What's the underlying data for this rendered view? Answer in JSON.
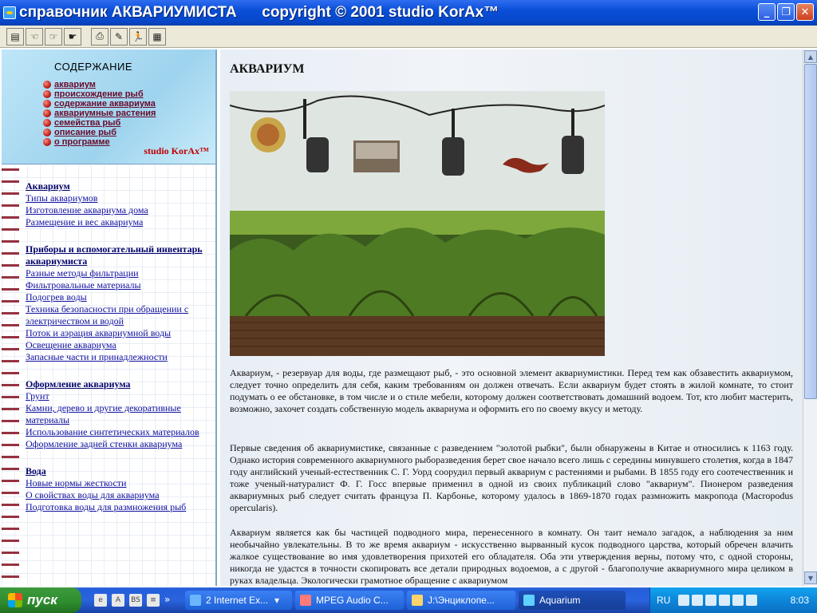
{
  "window": {
    "title": "справочник АКВАРИУМИСТА      copyright © 2001 studio KorAx™",
    "minimize": "_",
    "maximize": "❐",
    "close": "✕"
  },
  "toolbar": {
    "buttons": [
      {
        "icon": "contents-icon",
        "glyph": "▤"
      },
      {
        "icon": "back-hand-icon",
        "glyph": "☜"
      },
      {
        "icon": "forward-hand-icon",
        "glyph": "☞"
      },
      {
        "icon": "pointer-hand-icon",
        "glyph": "☛"
      },
      {
        "icon": "print-icon",
        "glyph": "⎙"
      },
      {
        "icon": "tools-icon",
        "glyph": "✎"
      },
      {
        "icon": "exit-runner-icon",
        "glyph": "🏃"
      },
      {
        "icon": "film-icon",
        "glyph": "▦"
      }
    ]
  },
  "toc": {
    "title": "СОДЕРЖАНИЕ",
    "items": [
      "аквариум",
      "происхождение рыб",
      "содержание аквариума",
      "аквариумные растения",
      "семейства рыб",
      "описание рыб",
      "о программе"
    ],
    "studio": "studio KorAx™"
  },
  "nav": {
    "sections": [
      {
        "head": "Аквариум",
        "items": [
          "Типы аквариумов",
          "Изготовление аквариума дома",
          "Размещение и вес аквариума"
        ]
      },
      {
        "head": "Приборы и вспомогательный инвентарь аквариумиста",
        "items": [
          "Разные методы фильтрации",
          "Фильтровальные материалы",
          "Подогрев воды",
          "Техника безопасности при обращении с электричеством и водой",
          "Поток и аэрация аквариумной воды",
          "Освещение аквариума",
          "Запасные части и принадлежности"
        ]
      },
      {
        "head": "Оформление аквариума",
        "items": [
          "Грунт",
          "Камни, дерево и другие декоративные материалы",
          "Использование синтетических материалов",
          "Оформление задней стенки аквариума"
        ]
      },
      {
        "head": "Вода",
        "items": [
          "Новые нормы жесткости",
          "О свойствах воды для аквариума",
          "Подготовка воды для размножения рыб"
        ]
      }
    ]
  },
  "content": {
    "title": "АКВАРИУМ",
    "paragraphs": [
      "Аквариум, - резервуар для воды, где размещают рыб, - это основной элемент аквариумистики. Перед тем как обзавестить аквариумом, следует точно определить для себя, каким требованиям он должен отвечать. Если аквариум будет стоять в жилой комнате, то стоит подумать о ее обстановке, в том числе и о стиле мебели, которому должен соответствовать домашний водоем. Тот, кто любит мастерить, возможно, захочет создать собственную модель аквариума и оформить его по своему вкусу и методу.",
      "Первые сведения об аквариумистике, связанные с разведением \"золотой рыбки\", были обнаружены в Китае и относились к 1163 году. Однако история современного аквариумного рыборазведения берет свое начало всего лишь с середины минувшего столетия, когда в 1847 году английский ученый-естественник С. Г. Уорд соорудил первый аквариум с растениями и рыбами. В 1855 году его соотечественник и тоже ученый-натуралист Ф. Г. Госс впервые применил в одной из своих публикаций слово \"аквариум\". Пионером разведения аквариумных рыб следует считать француза П. Карбонье, которому удалось в 1869-1870 годах размножить макропода (Macropodus opercularis).",
      "Аквариум является как бы частицей подводного мира, перенесенного в комнату. Он таит немало загадок, а наблюдения за ним необычайно увлекательны. В то же время аквариум - искусственно вырванный кусок подводного царства, который обречен влачить жалкое существование во имя удовлетворения прихотей его обладателя. Оба эти утверждения верны, потому что, с одной стороны, никогда не удастся в точности скопировать все детали природных водоемов, а с другой - благополучие аквариумного мира целиком в руках владельца. Экологически грамотное обращение с аквариумом"
    ]
  },
  "scrollbar": {
    "up": "▲",
    "down": "▼"
  },
  "taskbar": {
    "start_label": "пуск",
    "quick_icons": [
      "ie-icon",
      "acrobat-icon",
      "bs-icon",
      "notepad-icon"
    ],
    "quick_glyphs": [
      "e",
      "A",
      "BS",
      "≡"
    ],
    "overflow": "»",
    "tasks": [
      {
        "label": "2 Internet Ex...",
        "arrow": "▾",
        "active": false
      },
      {
        "label": "MPEG Audio C...",
        "active": false
      },
      {
        "label": "J:\\Энциклопе...",
        "active": false
      },
      {
        "label": "Aquarium",
        "active": true
      }
    ],
    "tray_lang": "RU",
    "clock": "8:03"
  }
}
